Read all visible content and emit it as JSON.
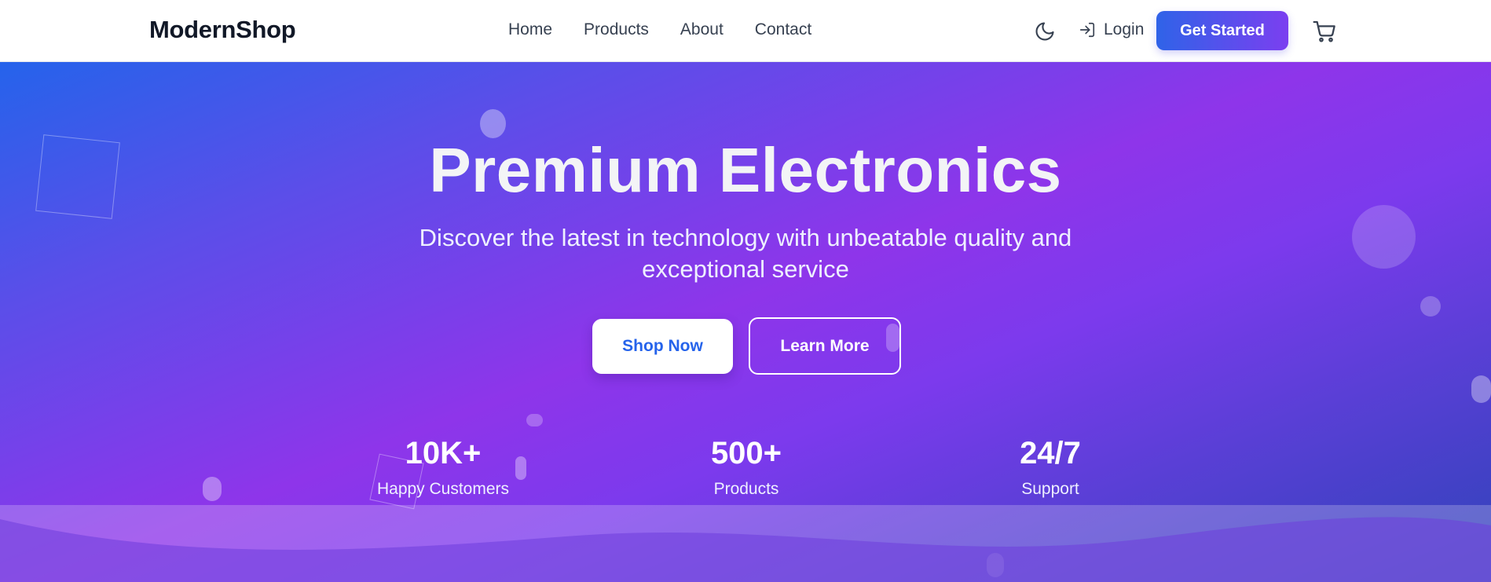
{
  "header": {
    "logo": "ModernShop",
    "nav": [
      "Home",
      "Products",
      "About",
      "Contact"
    ],
    "theme_icon": "moon-icon",
    "login_label": "Login",
    "login_icon": "login-arrow-icon",
    "cta_label": "Get Started",
    "cart_icon": "cart-icon"
  },
  "hero": {
    "title": "Premium Electronics",
    "subtitle": "Discover the latest in technology with unbeatable quality and exceptional service",
    "primary_button": "Shop Now",
    "secondary_button": "Learn More",
    "stats": [
      {
        "value": "10K+",
        "label": "Happy Customers"
      },
      {
        "value": "500+",
        "label": "Products"
      },
      {
        "value": "24/7",
        "label": "Support"
      }
    ]
  },
  "colors": {
    "accent_blue": "#2563eb",
    "accent_purple": "#9333ea",
    "text_dark": "#111827"
  }
}
